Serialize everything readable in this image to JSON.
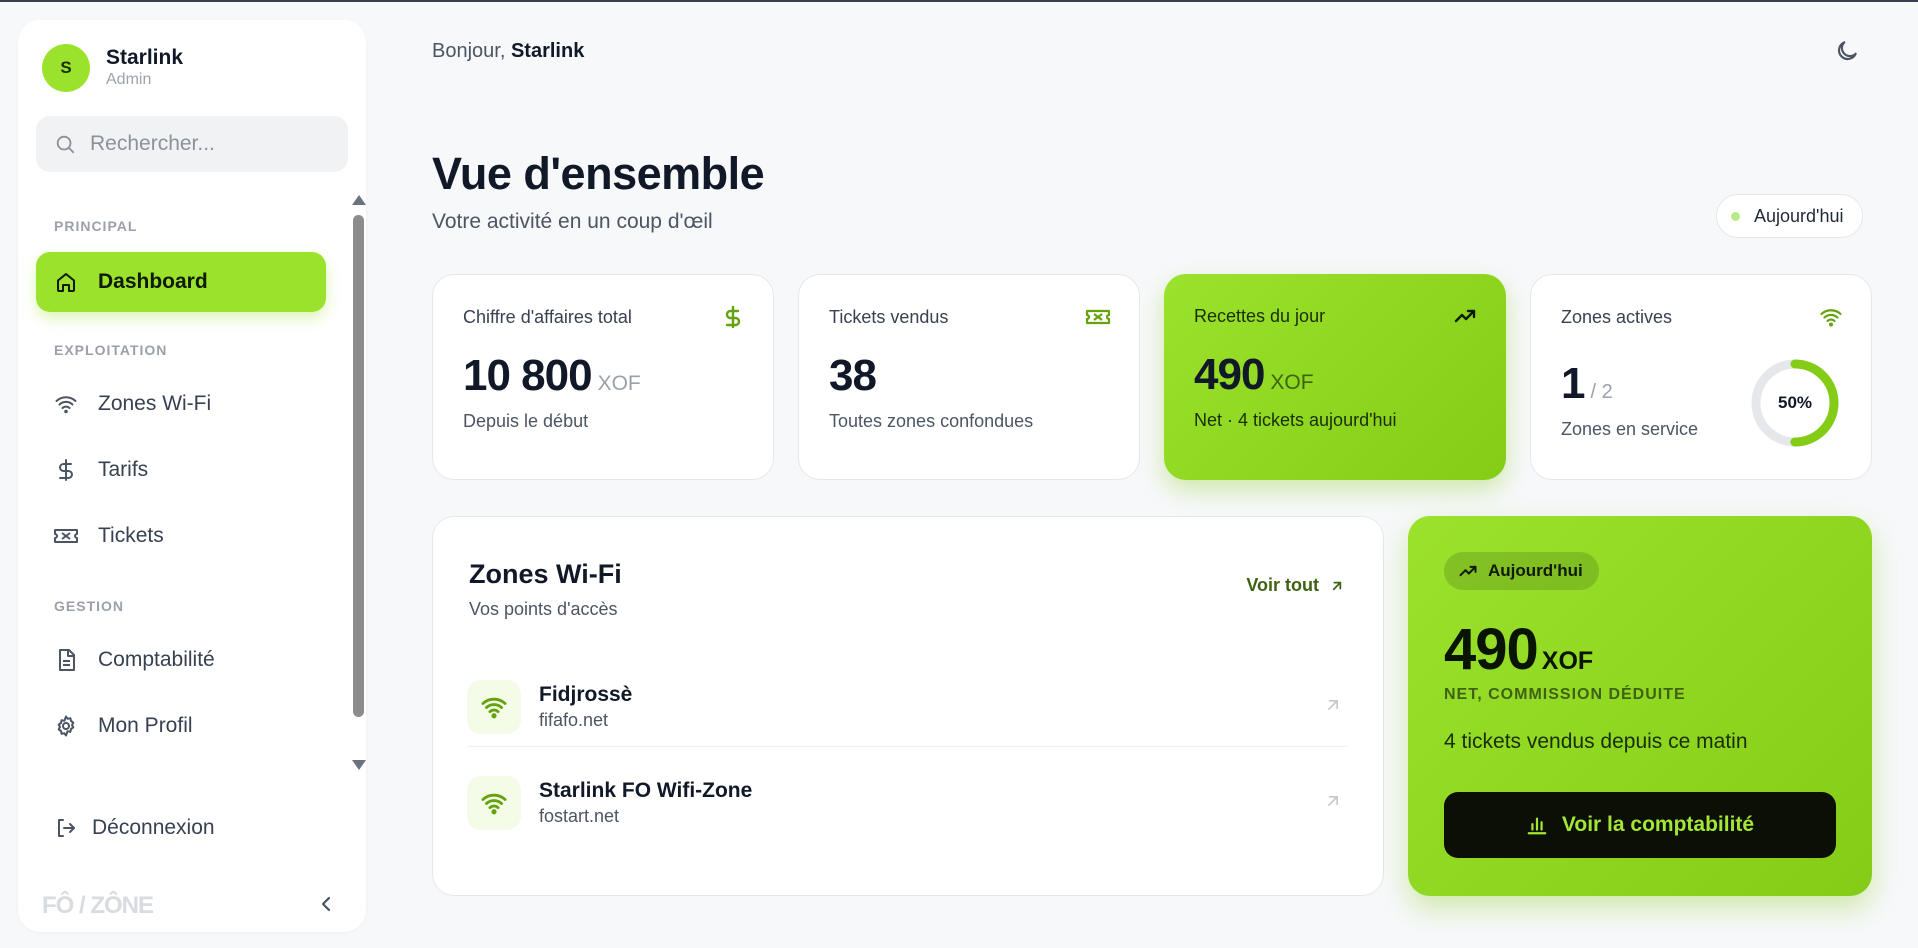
{
  "user": {
    "initial": "S",
    "name": "Starlink",
    "role": "Admin"
  },
  "search": {
    "placeholder": "Rechercher..."
  },
  "nav": {
    "sections": {
      "principal": "PRINCIPAL",
      "exploitation": "EXPLOITATION",
      "gestion": "GESTION"
    },
    "items": [
      {
        "label": "Dashboard",
        "icon": "home-icon",
        "active": true
      },
      {
        "label": "Zones Wi-Fi",
        "icon": "wifi-icon"
      },
      {
        "label": "Tarifs",
        "icon": "dollar-icon"
      },
      {
        "label": "Tickets",
        "icon": "ticket-icon"
      },
      {
        "label": "Comptabilité",
        "icon": "document-icon"
      },
      {
        "label": "Mon Profil",
        "icon": "gear-icon"
      }
    ],
    "logout": "Déconnexion"
  },
  "brand": {
    "logo": "FÔ / ZÔNE"
  },
  "header": {
    "greeting": "Bonjour,",
    "user": "Starlink"
  },
  "page": {
    "title": "Vue d'ensemble",
    "subtitle": "Votre activité en un coup d'œil",
    "period": "Aujourd'hui"
  },
  "stats": [
    {
      "label": "Chiffre d'affaires total",
      "value": "10 800",
      "unit": "XOF",
      "sub": "Depuis le début",
      "icon": "dollar-icon"
    },
    {
      "label": "Tickets vendus",
      "value": "38",
      "sub": "Toutes zones confondues",
      "icon": "ticket-icon"
    },
    {
      "label": "Recettes du jour",
      "value": "490",
      "unit": "XOF",
      "sub": "Net · 4 tickets aujourd'hui",
      "icon": "trending-up-icon"
    },
    {
      "label": "Zones actives",
      "value": "1",
      "total": "/ 2",
      "sub": "Zones en service",
      "percent": "50%",
      "fraction": 0.5,
      "icon": "wifi-icon"
    }
  ],
  "zones": {
    "title": "Zones Wi-Fi",
    "subtitle": "Vos points d'accès",
    "see_all": "Voir tout",
    "items": [
      {
        "name": "Fidjrossè",
        "domain": "fifafo.net"
      },
      {
        "name": "Starlink FO Wifi-Zone",
        "domain": "fostart.net"
      }
    ]
  },
  "promo": {
    "badge": "Aujourd'hui",
    "value": "490",
    "unit": "XOF",
    "caption": "NET, COMMISSION DÉDUITE",
    "text": "4 tickets vendus depuis ce matin",
    "button": "Voir la comptabilité"
  },
  "colors": {
    "accent": "#9be22c",
    "accent_dark": "#84cc16",
    "text": "#111827"
  }
}
